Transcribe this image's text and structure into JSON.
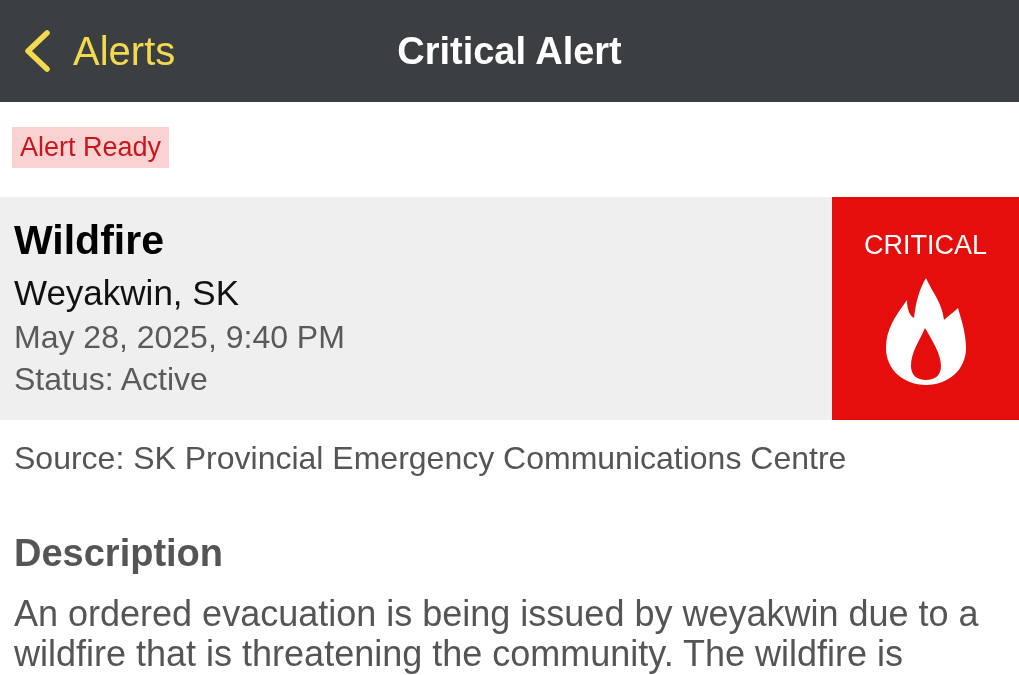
{
  "nav_bar": {
    "back_label": "Alerts",
    "title": "Critical Alert"
  },
  "badge": "Alert Ready",
  "alert": {
    "event": "Wildfire",
    "location": "Weyakwin, SK",
    "time": "May 28, 2025, 9:40 PM",
    "status": "Status: Active",
    "severity": "CRITICAL"
  },
  "source": "Source: SK Provincial Emergency Communications Centre",
  "description": {
    "heading": "Description",
    "text": "An ordered evacuation is being issued by weyakwin due to a wildfire that is threatening the community. The wildfire is"
  }
}
